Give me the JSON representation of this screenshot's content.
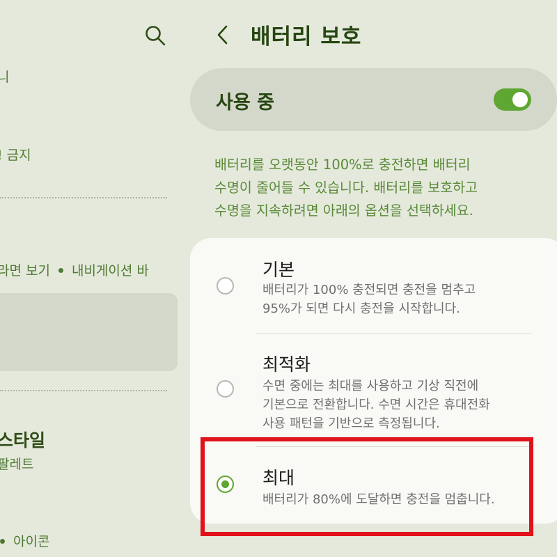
{
  "left_panel": {
    "fragment_1": "니",
    "fragment_2": "! 금지",
    "fragment_3": "라면 보기",
    "fragment_3b": "내비게이션 바",
    "style_title": "스타일",
    "style_subtitle": "팔레트",
    "icons_text": "아이콘"
  },
  "header": {
    "title": "배터리 보호"
  },
  "master_switch": {
    "label": "사용 중",
    "state": "on"
  },
  "description": {
    "line1": "배터리를 오랫동안 100%로 충전하면 배터리",
    "line2": "수명이 줄어들 수 있습니다. 배터리를 보호하고",
    "line3": "수명을 지속하려면 아래의 옵션을 선택하세요."
  },
  "options": [
    {
      "title": "기본",
      "desc_line1": "배터리가 100% 충전되면 충전을 멈추고",
      "desc_line2": "95%가 되면 다시 충전을 시작합니다.",
      "selected": false
    },
    {
      "title": "최적화",
      "desc_line1": "수면 중에는 최대를 사용하고 기상 직전에",
      "desc_line2": "기본으로 전환합니다. 수면 시간은 휴대전화",
      "desc_line3": "사용 패턴을 기반으로 측정됩니다.",
      "selected": false
    },
    {
      "title": "최대",
      "desc_line1": "배터리가 80%에 도달하면 충전을 멈춥니다.",
      "selected": true
    }
  ],
  "colors": {
    "background": "#e5e9dc",
    "accent": "#5ea732",
    "title": "#264611",
    "highlight": "#e0121a"
  }
}
